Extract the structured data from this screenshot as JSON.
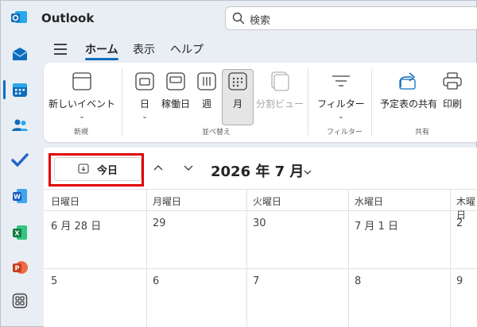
{
  "app": {
    "title": "Outlook"
  },
  "search": {
    "placeholder": "検索"
  },
  "menu": {
    "tabs": [
      {
        "label": "ホーム",
        "active": true
      },
      {
        "label": "表示",
        "active": false
      },
      {
        "label": "ヘルプ",
        "active": false
      }
    ]
  },
  "ribbon": {
    "new_event": "新しいイベント",
    "day": "日",
    "work_week": "稼働日",
    "week": "週",
    "month": "月",
    "split_view": "分割ビュー",
    "filter": "フィルター",
    "share": "予定表の共有",
    "print": "印刷",
    "groups": {
      "new": "新規",
      "arrange": "並べ替え",
      "filter": "フィルター",
      "share": "共有"
    }
  },
  "nav": {
    "today": "今日",
    "month_title": "2026 年 7 月"
  },
  "calendar": {
    "weekdays": [
      "日曜日",
      "月曜日",
      "火曜日",
      "水曜日",
      "木曜日"
    ],
    "rows": [
      [
        "6 月 28 日",
        "29",
        "30",
        "7 月 1 日",
        "2"
      ],
      [
        "5",
        "6",
        "7",
        "8",
        "9"
      ]
    ]
  },
  "colors": {
    "accent": "#0f6cbd",
    "highlight": "#e00000",
    "background": "#e9eef4"
  }
}
